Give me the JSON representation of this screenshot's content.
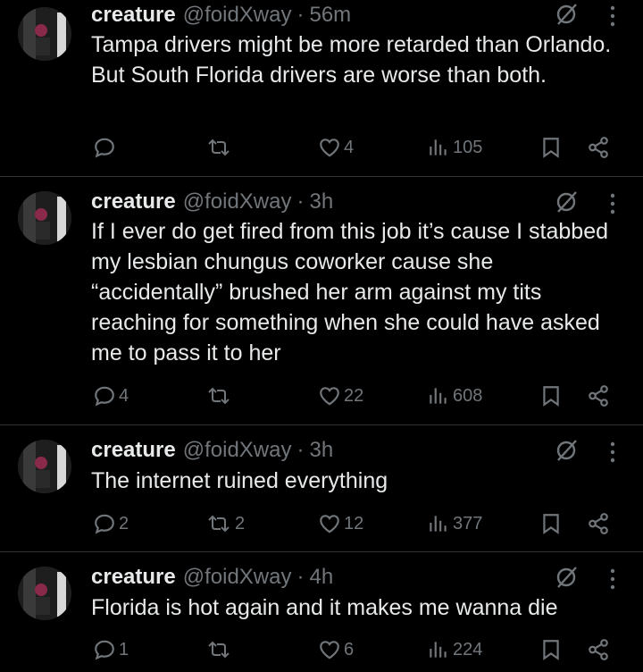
{
  "tweets": [
    {
      "name": "creature",
      "handle": "@foidXway",
      "separator": "·",
      "time": "56m",
      "text": "Tampa drivers might be more retarded than Orlando. But South Florida drivers are worse than both.",
      "replies": "",
      "retweets": "",
      "likes": "4",
      "views": "105"
    },
    {
      "name": "creature",
      "handle": "@foidXway",
      "separator": "·",
      "time": "3h",
      "text": "If I ever do get fired from this job it’s cause I stabbed my lesbian chungus coworker cause she “accidentally” brushed her arm against my tits reaching for something when she could have asked me to pass it to her",
      "replies": "4",
      "retweets": "",
      "likes": "22",
      "views": "608"
    },
    {
      "name": "creature",
      "handle": "@foidXway",
      "separator": "·",
      "time": "3h",
      "text": "The internet ruined everything",
      "replies": "2",
      "retweets": "2",
      "likes": "12",
      "views": "377"
    },
    {
      "name": "creature",
      "handle": "@foidXway",
      "separator": "·",
      "time": "4h",
      "text": "Florida is hot again and it makes me wanna die",
      "replies": "1",
      "retweets": "",
      "likes": "6",
      "views": "224"
    }
  ],
  "icons": {
    "reply": "reply-icon",
    "retweet": "retweet-icon",
    "like": "heart-icon",
    "views": "views-icon",
    "bookmark": "bookmark-icon",
    "share": "share-icon",
    "grok": "grok-icon",
    "more": "more-icon"
  },
  "colors": {
    "background": "#000000",
    "text": "#e7e9ea",
    "muted": "#71767b",
    "divider": "#2f3336"
  }
}
